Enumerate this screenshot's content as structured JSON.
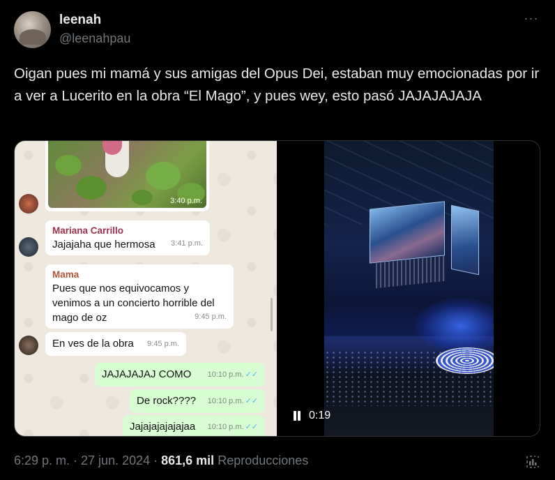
{
  "author": {
    "display_name": "leenah",
    "handle": "@leenahpau"
  },
  "tweet": {
    "text": "Oigan pues mi mamá y sus amigas del Opus Dei, estaban muy emocionadas por ir a ver a Lucerito en la obra “El Mago”, y pues wey, esto pasó JAJAJAJAJA",
    "more_icon": "more-horizontal-icon"
  },
  "chat": {
    "photo_time": "3:40 p.m.",
    "messages": [
      {
        "sender": "Mariana Carrillo",
        "text": "Jajajaha que hermosa",
        "time": "3:41 p.m."
      },
      {
        "sender": "Mama",
        "text": "Pues que nos equivocamos y venimos a un concierto horrible del mago de oz",
        "time": "9:45 p.m."
      },
      {
        "sender": "",
        "text": "En ves de la obra",
        "time": "9:45 p.m."
      }
    ],
    "outgoing": [
      {
        "text": "JAJAJAJAJ COMO",
        "time": "10:10 p.m."
      },
      {
        "text": "De rock????",
        "time": "10:10 p.m."
      },
      {
        "text": "Jajajajajajajaa",
        "time": "10:10 p.m."
      }
    ],
    "sender_colors": {
      "Mariana Carrillo": "#a0324e",
      "Mama": "#b2563a"
    }
  },
  "video": {
    "state_icon": "pause-icon",
    "time": "0:19"
  },
  "meta": {
    "timestamp": "6:29 p. m. · 27 jun. 2024 · ",
    "views_count": "861,6 mil",
    "views_label": " Reproducciones",
    "analytics_icon": "analytics-icon"
  },
  "colors": {
    "background": "#000000",
    "text_primary": "#e7e9ea",
    "text_secondary": "#71767b",
    "outgoing_bubble": "#d9fdd3",
    "read_ticks": "#4fb6ec"
  }
}
